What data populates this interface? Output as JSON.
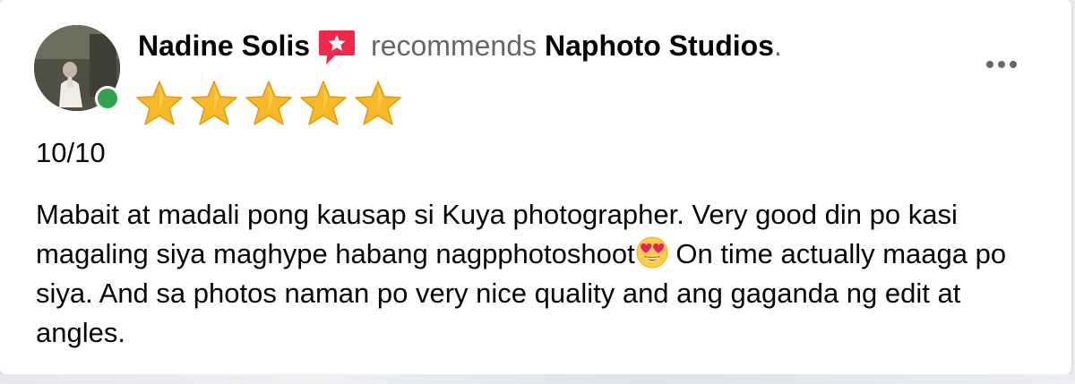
{
  "review": {
    "author_name": "Nadine Solis",
    "author_status": "online",
    "recommend_badge_icon": "recommend-badge-icon",
    "action_text": "recommends",
    "page_name": "Naphoto Studios",
    "punctuation": ".",
    "rating_stars": 5,
    "rating_max": 5,
    "score_text": "10/10",
    "body_before_emoji": "Mabait at madali pong kausap si Kuya photographer. Very good din po kasi magaling siya maghype habang nagpphotoshoot",
    "body_emoji": "heart-eyes-emoji",
    "body_after_emoji": " On time actually maaga po siya. And sa photos naman po very nice quality and ang gaganda ng edit at angles."
  },
  "menu": {
    "icon": "more-options-icon"
  },
  "colors": {
    "online_dot": "#31a24c",
    "secondary_text": "#65676b",
    "primary_text": "#050505",
    "star": "#f7b928",
    "badge": "#f02849"
  }
}
